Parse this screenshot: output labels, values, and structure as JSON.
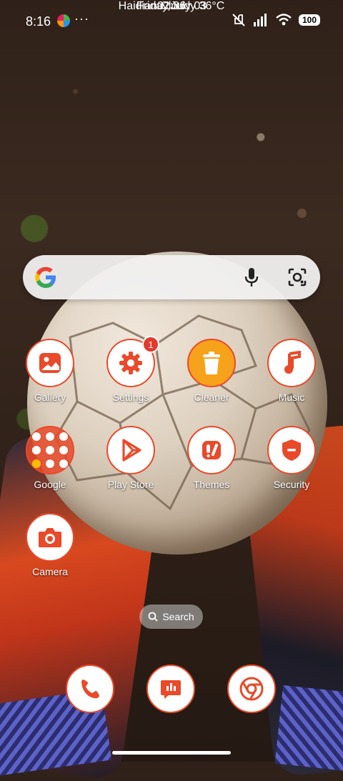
{
  "status_bar": {
    "time": "8:16",
    "more": "···",
    "battery": "100"
  },
  "lock_clock": {
    "time": "02:36",
    "date": "Friday,July 03",
    "weather": "Haidian Cloudy 36°C"
  },
  "search_widget": {
    "google_icon": "google-g-icon",
    "mic_icon": "mic-icon",
    "lens_icon": "lens-icon"
  },
  "apps": [
    {
      "label": "Gallery",
      "icon": "gallery-icon"
    },
    {
      "label": "Settings",
      "icon": "settings-icon",
      "badge": "1"
    },
    {
      "label": "Cleaner",
      "icon": "trash-icon"
    },
    {
      "label": "Music",
      "icon": "music-icon"
    },
    {
      "label": "Google",
      "icon": "google-folder-icon"
    },
    {
      "label": "Play Store",
      "icon": "play-store-icon"
    },
    {
      "label": "Themes",
      "icon": "themes-icon"
    },
    {
      "label": "Security",
      "icon": "security-icon"
    },
    {
      "label": "Camera",
      "icon": "camera-icon"
    }
  ],
  "search_pill": {
    "label": "Search"
  },
  "dock": [
    {
      "icon": "phone-icon"
    },
    {
      "icon": "messages-icon"
    },
    {
      "icon": "chrome-icon"
    }
  ],
  "colors": {
    "accent": "#e84a2a",
    "cleaner_fill": "#f7a21b"
  }
}
